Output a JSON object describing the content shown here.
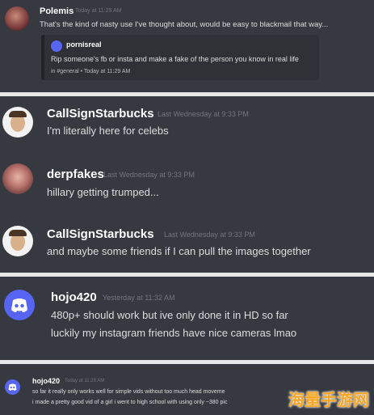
{
  "messages": [
    {
      "username": "Polemis",
      "timestamp": "Today at 11:29 AM",
      "text": "That's the kind of nasty use I've thought about, would be easy to blackmail that way...",
      "embed": {
        "author": "pornisreal",
        "body": "Rip someone's fb or insta and make a fake of the person you know in real life",
        "footer": "in #general • Today at 11:29 AM"
      }
    },
    {
      "username": "CallSignStarbucks",
      "timestamp": "Last Wednesday at 9:33 PM",
      "text": "I'm literally here for celebs"
    },
    {
      "username": "derpfakes",
      "timestamp": "Last Wednesday at 9:33 PM",
      "text": "hillary getting trumped..."
    },
    {
      "username": "CallSignStarbucks",
      "timestamp": "Last Wednesday at 9:33 PM",
      "text": "and maybe some friends if I can pull the images together"
    },
    {
      "username": "hojo420",
      "timestamp": "Yesterday at 11:32 AM",
      "lines": [
        "480p+ should work but ive only done it in HD so far",
        "luckily my instagram friends have nice cameras lmao"
      ]
    },
    {
      "username": "hojo420",
      "timestamp": "Today at 11:29 AM",
      "lines": [
        "so far it really only works well for simple vids without too much head moveme",
        "i made a pretty good vid of a girl i went to high school with using only ~380 pic"
      ]
    }
  ],
  "watermark": "海量手游网"
}
